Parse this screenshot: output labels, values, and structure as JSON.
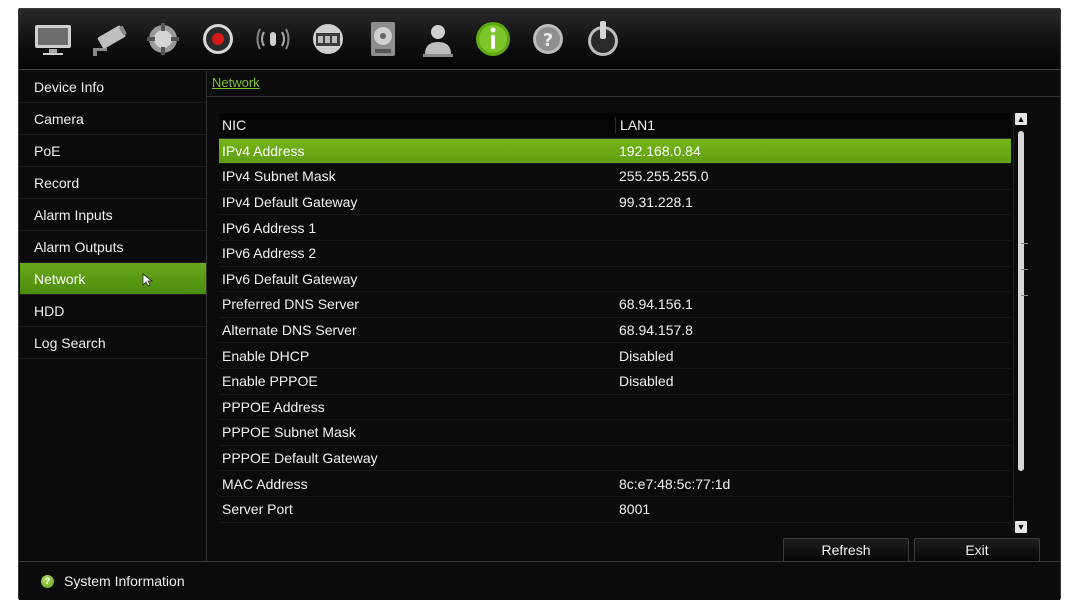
{
  "toolbar": {
    "icons": [
      "monitor-icon",
      "camera-icon",
      "ptz-icon",
      "record-icon",
      "alarm-icon",
      "network-icon",
      "hdd-icon",
      "user-icon",
      "info-icon",
      "help-icon",
      "power-icon"
    ],
    "active": "info-icon",
    "accent_color": "#6aa71c"
  },
  "sidebar": {
    "items": [
      {
        "label": "Device Info"
      },
      {
        "label": "Camera"
      },
      {
        "label": "PoE"
      },
      {
        "label": "Record"
      },
      {
        "label": "Alarm Inputs"
      },
      {
        "label": "Alarm Outputs"
      },
      {
        "label": "Network"
      },
      {
        "label": "HDD"
      },
      {
        "label": "Log Search"
      }
    ],
    "active_label": "Network"
  },
  "main": {
    "breadcrumb": "Network",
    "table": {
      "header": {
        "name": "NIC",
        "value": "LAN1"
      },
      "rows": [
        {
          "name": "IPv4 Address",
          "value": "192.168.0.84"
        },
        {
          "name": "IPv4 Subnet Mask",
          "value": "255.255.255.0"
        },
        {
          "name": "IPv4 Default Gateway",
          "value": "99.31.228.1"
        },
        {
          "name": "IPv6 Address 1",
          "value": ""
        },
        {
          "name": "IPv6 Address 2",
          "value": ""
        },
        {
          "name": "IPv6 Default Gateway",
          "value": ""
        },
        {
          "name": "Preferred DNS Server",
          "value": "68.94.156.1"
        },
        {
          "name": "Alternate DNS Server",
          "value": "68.94.157.8"
        },
        {
          "name": "Enable DHCP",
          "value": "Disabled"
        },
        {
          "name": "Enable PPPOE",
          "value": "Disabled"
        },
        {
          "name": "PPPOE Address",
          "value": ""
        },
        {
          "name": "PPPOE Subnet Mask",
          "value": ""
        },
        {
          "name": "PPPOE Default Gateway",
          "value": ""
        },
        {
          "name": "MAC Address",
          "value": "8c:e7:48:5c:77:1d"
        },
        {
          "name": "Server Port",
          "value": "8001"
        }
      ],
      "selected_row": "IPv4 Address"
    },
    "buttons": {
      "refresh": "Refresh",
      "exit": "Exit"
    }
  },
  "statusbar": {
    "icon": "help-icon",
    "label": "System Information"
  }
}
